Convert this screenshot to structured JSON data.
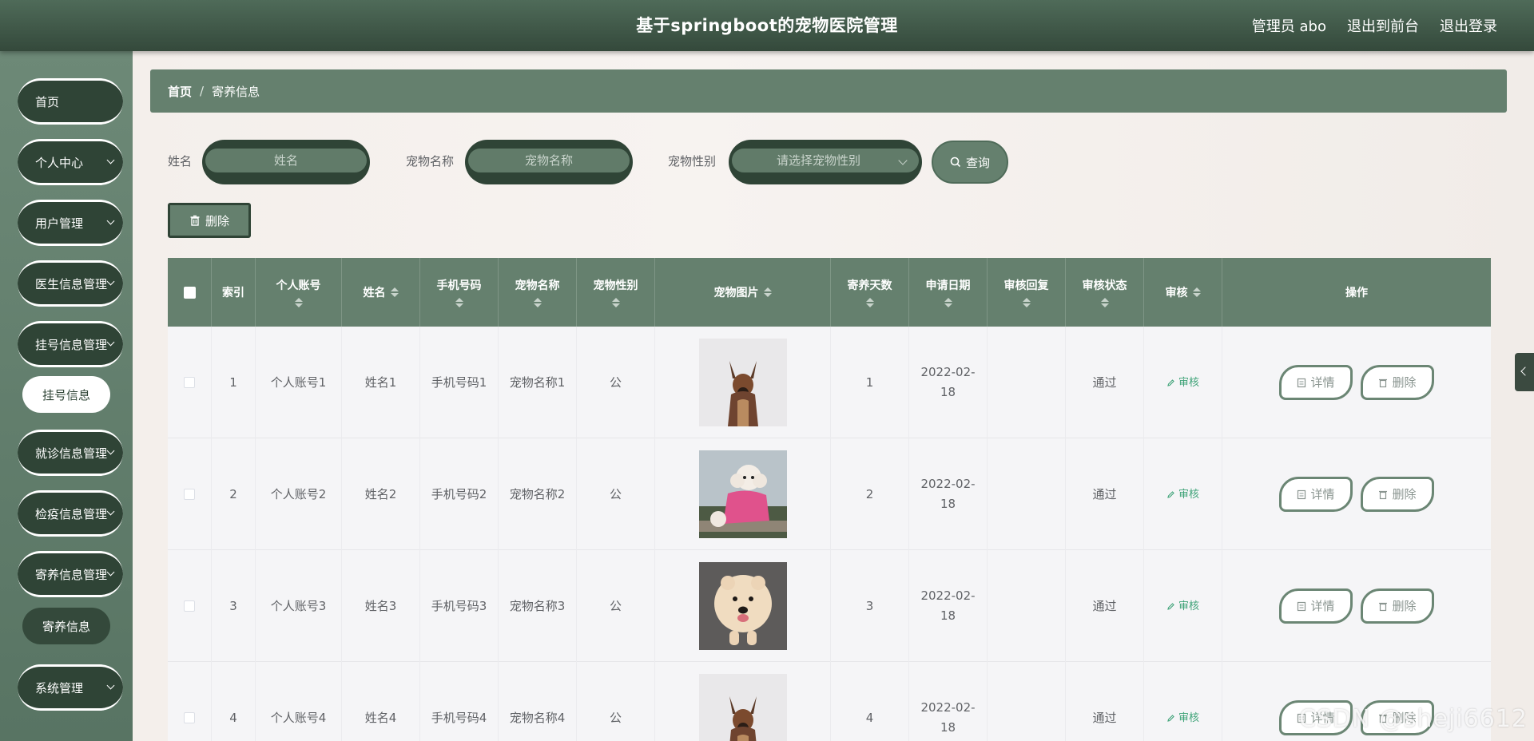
{
  "header": {
    "title": "基于springboot的宠物医院管理",
    "user": "管理员 abo",
    "to_front": "退出到前台",
    "logout": "退出登录"
  },
  "sidebar": {
    "items": [
      {
        "label": "首页",
        "has_children": false
      },
      {
        "label": "个人中心",
        "has_children": true
      },
      {
        "label": "用户管理",
        "has_children": true
      },
      {
        "label": "医生信息管理",
        "has_children": true
      },
      {
        "label": "挂号信息管理",
        "has_children": true
      },
      {
        "label": "挂号信息",
        "sub": true
      },
      {
        "label": "就诊信息管理",
        "has_children": true
      },
      {
        "label": "检疫信息管理",
        "has_children": true
      },
      {
        "label": "寄养信息管理",
        "has_children": true
      },
      {
        "label": "寄养信息",
        "sub": true
      },
      {
        "label": "系统管理",
        "has_children": true
      }
    ]
  },
  "breadcrumb": {
    "home": "首页",
    "sep": "/",
    "current": "寄养信息"
  },
  "search": {
    "name_label": "姓名",
    "name_placeholder": "姓名",
    "pet_label": "宠物名称",
    "pet_placeholder": "宠物名称",
    "gender_label": "宠物性别",
    "gender_placeholder": "请选择宠物性别",
    "query_label": "查询"
  },
  "toolbar": {
    "delete_label": "删除"
  },
  "table": {
    "columns": [
      "索引",
      "个人账号",
      "姓名",
      "手机号码",
      "宠物名称",
      "宠物性别",
      "宠物图片",
      "寄养天数",
      "申请日期",
      "审核回复",
      "审核状态",
      "审核",
      "操作"
    ],
    "audit_label": "审核",
    "detail_label": "详情",
    "delete_label": "删除",
    "rows": [
      {
        "index": "1",
        "account": "个人账号1",
        "name": "姓名1",
        "phone": "手机号码1",
        "pet": "宠物名称1",
        "gender": "公",
        "days": "1",
        "date": "2022-02-18",
        "reply": "",
        "status": "通过"
      },
      {
        "index": "2",
        "account": "个人账号2",
        "name": "姓名2",
        "phone": "手机号码2",
        "pet": "宠物名称2",
        "gender": "公",
        "days": "2",
        "date": "2022-02-18",
        "reply": "",
        "status": "通过"
      },
      {
        "index": "3",
        "account": "个人账号3",
        "name": "姓名3",
        "phone": "手机号码3",
        "pet": "宠物名称3",
        "gender": "公",
        "days": "3",
        "date": "2022-02-18",
        "reply": "",
        "status": "通过"
      },
      {
        "index": "4",
        "account": "个人账号4",
        "name": "姓名4",
        "phone": "手机号码4",
        "pet": "宠物名称4",
        "gender": "公",
        "days": "4",
        "date": "2022-02-18",
        "reply": "",
        "status": "通过"
      }
    ]
  },
  "watermark": "CSDN @sheji6612",
  "colors": {
    "header": "#34493b",
    "accent": "#65806e",
    "sidebar_dark": "#2f4436",
    "audit": "#3fa378"
  }
}
